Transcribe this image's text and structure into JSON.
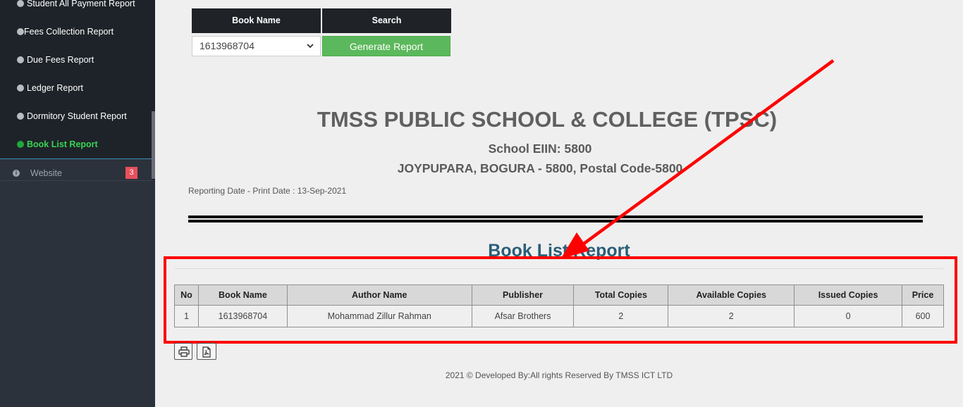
{
  "sidebar": {
    "submenu": [
      {
        "label": "Student All Payment Report",
        "active": false
      },
      {
        "label": "Fees Collection Report",
        "active": false
      },
      {
        "label": "Due Fees Report",
        "active": false
      },
      {
        "label": "Ledger Report",
        "active": false
      },
      {
        "label": "Dormitory Student Report",
        "active": false
      },
      {
        "label": "Book List Report",
        "active": true
      }
    ],
    "website": {
      "label": "Website",
      "badge": "3"
    }
  },
  "search_form": {
    "book_name_header": "Book Name",
    "search_header": "Search",
    "selected_book": "1613968704",
    "generate_button": "Generate Report"
  },
  "report": {
    "school_name": "TMSS PUBLIC SCHOOL & COLLEGE (TPSC)",
    "eiin": "School EIIN: 5800",
    "address": "JOYPUPARA, BOGURA - 5800, Postal Code-5800",
    "reporting_date": "Reporting Date - Print Date : 13-Sep-2021",
    "title": "Book List Report"
  },
  "table": {
    "headers": [
      "No",
      "Book Name",
      "Author Name",
      "Publisher",
      "Total Copies",
      "Available Copies",
      "Issued Copies",
      "Price"
    ],
    "rows": [
      [
        "1",
        "1613968704",
        "Mohammad Zillur Rahman",
        "Afsar Brothers",
        "2",
        "2",
        "0",
        "600"
      ]
    ]
  },
  "actions": {
    "print_icon": "print-icon",
    "pdf_icon": "pdf-icon"
  },
  "footer": {
    "text": "2021 © Developed By:All rights Reserved By TMSS ICT LTD"
  },
  "annotation": {
    "highlight_color": "#ff0000",
    "arrow_color": "#ff0000"
  }
}
